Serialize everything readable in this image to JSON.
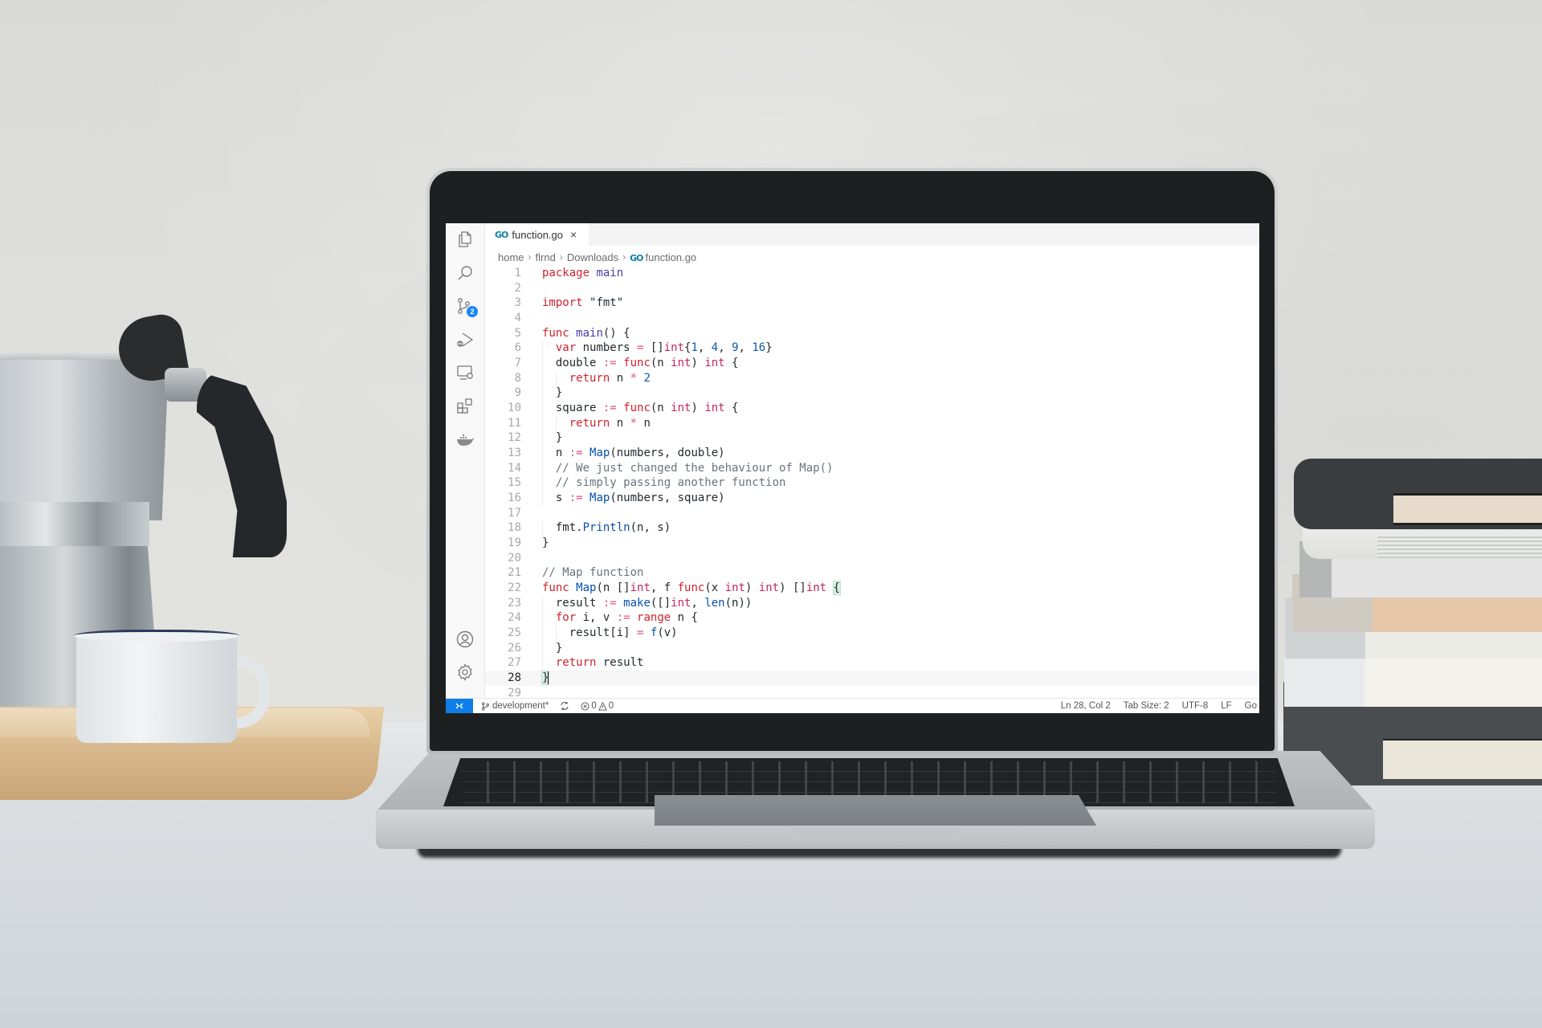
{
  "scene": {
    "description_objects": [
      "moka-pot",
      "enamel-mug",
      "wooden-tray",
      "laptop",
      "book-stack"
    ]
  },
  "editor_app": {
    "activity_bar": [
      {
        "id": "explorer",
        "icon": "files-icon"
      },
      {
        "id": "search",
        "icon": "search-icon"
      },
      {
        "id": "source-control",
        "icon": "source-control-icon",
        "badge": "2"
      },
      {
        "id": "run-debug",
        "icon": "run-debug-icon"
      },
      {
        "id": "remote-explorer",
        "icon": "remote-explorer-icon"
      },
      {
        "id": "extensions",
        "icon": "extensions-icon"
      },
      {
        "id": "docker",
        "icon": "docker-icon"
      },
      {
        "id": "accounts",
        "icon": "account-icon"
      },
      {
        "id": "manage",
        "icon": "gear-icon"
      }
    ],
    "tab": {
      "icon_text": "GO",
      "label": "function.go",
      "close": "×"
    },
    "breadcrumb": {
      "items": [
        "home",
        "flrnd",
        "Downloads"
      ],
      "file_icon_text": "GO",
      "file": "function.go",
      "separator": "›"
    },
    "current_line": 28,
    "code_lines": [
      [
        [
          "kw",
          "package"
        ],
        [
          "p",
          " "
        ],
        [
          "fn2",
          "main"
        ]
      ],
      [],
      [
        [
          "kw",
          "import"
        ],
        [
          "p",
          " "
        ],
        [
          "str",
          "\"fmt\""
        ]
      ],
      [],
      [
        [
          "kw",
          "func"
        ],
        [
          "p",
          " "
        ],
        [
          "fn2",
          "main"
        ],
        [
          "p",
          "() {"
        ]
      ],
      [
        [
          "p",
          "  "
        ],
        [
          "kw",
          "var"
        ],
        [
          "p",
          " numbers "
        ],
        [
          "op",
          "="
        ],
        [
          "p",
          " []"
        ],
        [
          "type",
          "int"
        ],
        [
          "p",
          "{"
        ],
        [
          "num",
          "1"
        ],
        [
          "p",
          ", "
        ],
        [
          "num",
          "4"
        ],
        [
          "p",
          ", "
        ],
        [
          "num",
          "9"
        ],
        [
          "p",
          ", "
        ],
        [
          "num",
          "16"
        ],
        [
          "p",
          "}"
        ]
      ],
      [
        [
          "p",
          "  double "
        ],
        [
          "op",
          ":="
        ],
        [
          "p",
          " "
        ],
        [
          "kw",
          "func"
        ],
        [
          "p",
          "(n "
        ],
        [
          "type",
          "int"
        ],
        [
          "p",
          ") "
        ],
        [
          "type",
          "int"
        ],
        [
          "p",
          " {"
        ]
      ],
      [
        [
          "p",
          "    "
        ],
        [
          "kw",
          "return"
        ],
        [
          "p",
          " n "
        ],
        [
          "op",
          "*"
        ],
        [
          "p",
          " "
        ],
        [
          "num",
          "2"
        ]
      ],
      [
        [
          "p",
          "  }"
        ]
      ],
      [
        [
          "p",
          "  square "
        ],
        [
          "op",
          ":="
        ],
        [
          "p",
          " "
        ],
        [
          "kw",
          "func"
        ],
        [
          "p",
          "(n "
        ],
        [
          "type",
          "int"
        ],
        [
          "p",
          ") "
        ],
        [
          "type",
          "int"
        ],
        [
          "p",
          " {"
        ]
      ],
      [
        [
          "p",
          "    "
        ],
        [
          "kw",
          "return"
        ],
        [
          "p",
          " n "
        ],
        [
          "op",
          "*"
        ],
        [
          "p",
          " n"
        ]
      ],
      [
        [
          "p",
          "  }"
        ]
      ],
      [
        [
          "p",
          "  n "
        ],
        [
          "op",
          ":="
        ],
        [
          "p",
          " "
        ],
        [
          "fn",
          "Map"
        ],
        [
          "p",
          "(numbers, double)"
        ]
      ],
      [
        [
          "p",
          "  "
        ],
        [
          "cm",
          "// We just changed the behaviour of Map()"
        ]
      ],
      [
        [
          "p",
          "  "
        ],
        [
          "cm",
          "// simply passing another function"
        ]
      ],
      [
        [
          "p",
          "  s "
        ],
        [
          "op",
          ":="
        ],
        [
          "p",
          " "
        ],
        [
          "fn",
          "Map"
        ],
        [
          "p",
          "(numbers, square)"
        ]
      ],
      [],
      [
        [
          "p",
          "  fmt."
        ],
        [
          "fn",
          "Println"
        ],
        [
          "p",
          "(n, s)"
        ]
      ],
      [
        [
          "p",
          "}"
        ]
      ],
      [],
      [
        [
          "cm",
          "// Map function"
        ]
      ],
      [
        [
          "kw",
          "func"
        ],
        [
          "p",
          " "
        ],
        [
          "fn",
          "Map"
        ],
        [
          "p",
          "(n []"
        ],
        [
          "type",
          "int"
        ],
        [
          "p",
          ", f "
        ],
        [
          "kw",
          "func"
        ],
        [
          "p",
          "(x "
        ],
        [
          "type",
          "int"
        ],
        [
          "p",
          ") "
        ],
        [
          "type",
          "int"
        ],
        [
          "p",
          ") []"
        ],
        [
          "type",
          "int"
        ],
        [
          "p",
          " "
        ],
        [
          "brace",
          "{"
        ]
      ],
      [
        [
          "p",
          "  result "
        ],
        [
          "op",
          ":="
        ],
        [
          "p",
          " "
        ],
        [
          "fn",
          "make"
        ],
        [
          "p",
          "([]"
        ],
        [
          "type",
          "int"
        ],
        [
          "p",
          ", "
        ],
        [
          "fn",
          "len"
        ],
        [
          "p",
          "(n))"
        ]
      ],
      [
        [
          "p",
          "  "
        ],
        [
          "kw",
          "for"
        ],
        [
          "p",
          " i, v "
        ],
        [
          "op",
          ":="
        ],
        [
          "p",
          " "
        ],
        [
          "kw",
          "range"
        ],
        [
          "p",
          " n {"
        ]
      ],
      [
        [
          "p",
          "    result[i] "
        ],
        [
          "op",
          "="
        ],
        [
          "p",
          " "
        ],
        [
          "fn",
          "f"
        ],
        [
          "p",
          "(v)"
        ]
      ],
      [
        [
          "p",
          "  }"
        ]
      ],
      [
        [
          "p",
          "  "
        ],
        [
          "kw",
          "return"
        ],
        [
          "p",
          " result"
        ]
      ],
      [
        [
          "brace",
          "}"
        ],
        [
          "cursor",
          ""
        ]
      ],
      []
    ],
    "status_bar": {
      "remote_icon": "remote-icon",
      "branch": "development*",
      "sync_icon": "sync-icon",
      "errors": "0",
      "warnings": "0",
      "cursor_position": "Ln 28, Col 2",
      "tab_size": "Tab Size: 2",
      "encoding": "UTF-8",
      "eol": "LF",
      "language": "Go"
    },
    "colors": {
      "accent": "#0e7fe8",
      "badge": "#1a85ff",
      "keyword": "#cf222e",
      "function": "#0550ae",
      "comment": "#6a737d"
    }
  }
}
